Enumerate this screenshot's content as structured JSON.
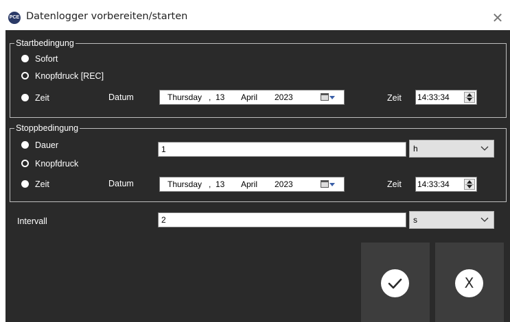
{
  "window": {
    "title": "Datenlogger vorbereiten/starten",
    "app_icon_text": "PCE",
    "close_glyph": "✕"
  },
  "start": {
    "legend": "Startbedingung",
    "options": [
      "Sofort",
      "Knopfdruck [REC]",
      "Zeit"
    ],
    "date_label": "Datum",
    "date": {
      "weekday": "Thursday",
      "sep": ",",
      "day": "13",
      "month": "April",
      "year": "2023"
    },
    "time_label": "Zeit",
    "time": "14:33:34"
  },
  "stop": {
    "legend": "Stoppbedingung",
    "options": [
      "Dauer",
      "Knopfdruck",
      "Zeit"
    ],
    "duration_value": "1",
    "duration_unit": "h",
    "date_label": "Datum",
    "date": {
      "weekday": "Thursday",
      "sep": ",",
      "day": "13",
      "month": "April",
      "year": "2023"
    },
    "time_label": "Zeit",
    "time": "14:33:34"
  },
  "interval": {
    "label": "Intervall",
    "value": "2",
    "unit": "s"
  },
  "buttons": {
    "ok_icon": "checkmark-icon",
    "cancel_glyph": "X"
  },
  "colors": {
    "client_bg": "#2a2a2a",
    "button_bg": "#3d3d3d",
    "text": "#ffffff"
  }
}
